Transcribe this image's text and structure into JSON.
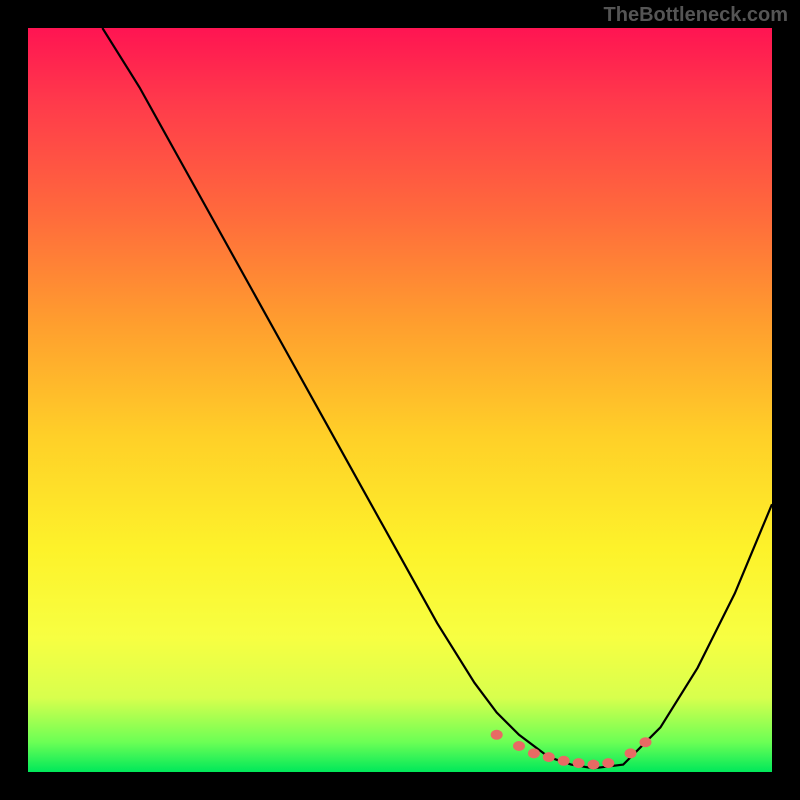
{
  "watermark": "TheBottleneck.com",
  "chart_data": {
    "type": "line",
    "title": "",
    "xlabel": "",
    "ylabel": "",
    "xlim": [
      0,
      100
    ],
    "ylim": [
      0,
      100
    ],
    "series": [
      {
        "name": "curve",
        "x": [
          10,
          15,
          20,
          25,
          30,
          35,
          40,
          45,
          50,
          55,
          60,
          63,
          66,
          70,
          73,
          76,
          80,
          85,
          90,
          95,
          100
        ],
        "y": [
          100,
          92,
          83,
          74,
          65,
          56,
          47,
          38,
          29,
          20,
          12,
          8,
          5,
          2,
          1,
          0.5,
          1,
          6,
          14,
          24,
          36
        ]
      }
    ],
    "markers": {
      "name": "highlighted-region",
      "points": [
        {
          "x": 63,
          "y": 5
        },
        {
          "x": 66,
          "y": 3.5
        },
        {
          "x": 68,
          "y": 2.5
        },
        {
          "x": 70,
          "y": 2
        },
        {
          "x": 72,
          "y": 1.5
        },
        {
          "x": 74,
          "y": 1.2
        },
        {
          "x": 76,
          "y": 1
        },
        {
          "x": 78,
          "y": 1.2
        },
        {
          "x": 81,
          "y": 2.5
        },
        {
          "x": 83,
          "y": 4
        }
      ]
    },
    "gradient_colors": [
      "#ff1452",
      "#ff6a3c",
      "#ffd028",
      "#f7ff42",
      "#00e85a"
    ]
  }
}
